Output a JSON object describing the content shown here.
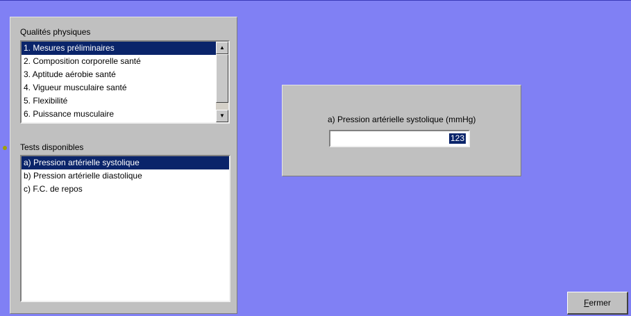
{
  "qualites": {
    "label": "Qualités physiques",
    "items": [
      {
        "label": "1. Mesures préliminaires",
        "selected": true
      },
      {
        "label": "2. Composition corporelle santé",
        "selected": false
      },
      {
        "label": "3. Aptitude aérobie santé",
        "selected": false
      },
      {
        "label": "4. Vigueur musculaire santé",
        "selected": false
      },
      {
        "label": "5. Flexibilité",
        "selected": false
      },
      {
        "label": "6. Puissance musculaire",
        "selected": false
      }
    ],
    "scroll_up_glyph": "▲",
    "scroll_down_glyph": "▼"
  },
  "tests": {
    "label": "Tests disponibles",
    "items": [
      {
        "label": "a) Pression artérielle systolique",
        "selected": true
      },
      {
        "label": "b) Pression artérielle diastolique",
        "selected": false
      },
      {
        "label": "c) F.C. de repos",
        "selected": false
      }
    ]
  },
  "measurement": {
    "label": "a) Pression artérielle systolique  (mmHg)",
    "value": "123"
  },
  "close_button": {
    "accel": "F",
    "rest": "ermer"
  }
}
